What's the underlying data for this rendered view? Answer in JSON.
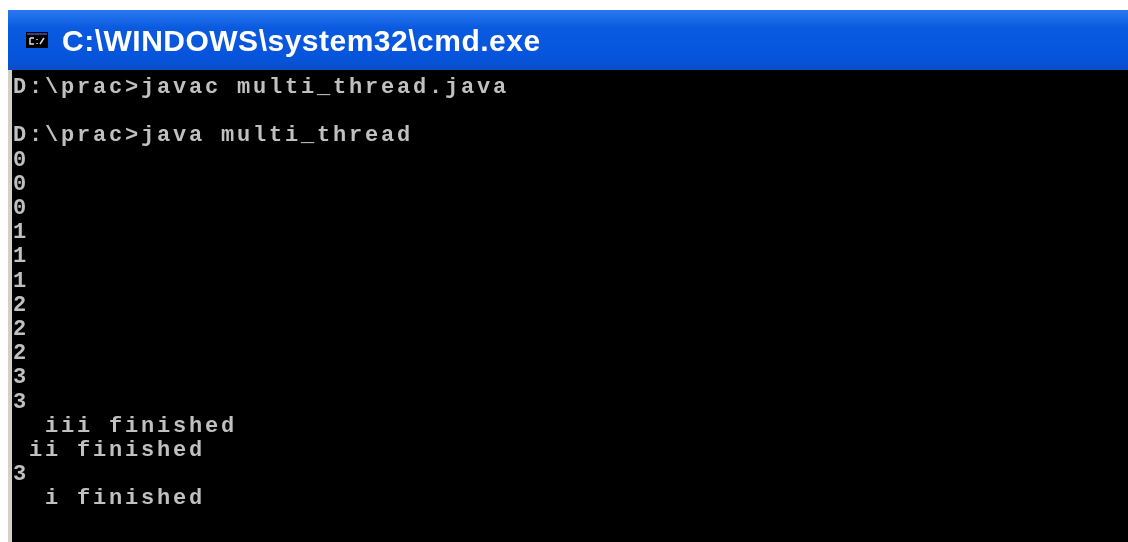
{
  "window": {
    "title": "C:\\WINDOWS\\system32\\cmd.exe"
  },
  "console": {
    "lines": [
      {
        "kind": "text",
        "text": "D:\\prac>javac multi_thread.java"
      },
      {
        "kind": "blank"
      },
      {
        "kind": "text",
        "text": "D:\\prac>java multi_thread"
      },
      {
        "kind": "text",
        "text": "0"
      },
      {
        "kind": "text",
        "text": "0"
      },
      {
        "kind": "text",
        "text": "0"
      },
      {
        "kind": "text",
        "text": "1"
      },
      {
        "kind": "text",
        "text": "1"
      },
      {
        "kind": "text",
        "text": "1"
      },
      {
        "kind": "text",
        "text": "2"
      },
      {
        "kind": "text",
        "text": "2"
      },
      {
        "kind": "text",
        "text": "2"
      },
      {
        "kind": "text",
        "text": "3"
      },
      {
        "kind": "text",
        "text": "3"
      },
      {
        "kind": "text",
        "text": "  iii finished"
      },
      {
        "kind": "text",
        "text": " ii finished"
      },
      {
        "kind": "text",
        "text": "3"
      },
      {
        "kind": "text",
        "text": "  i finished"
      }
    ]
  }
}
